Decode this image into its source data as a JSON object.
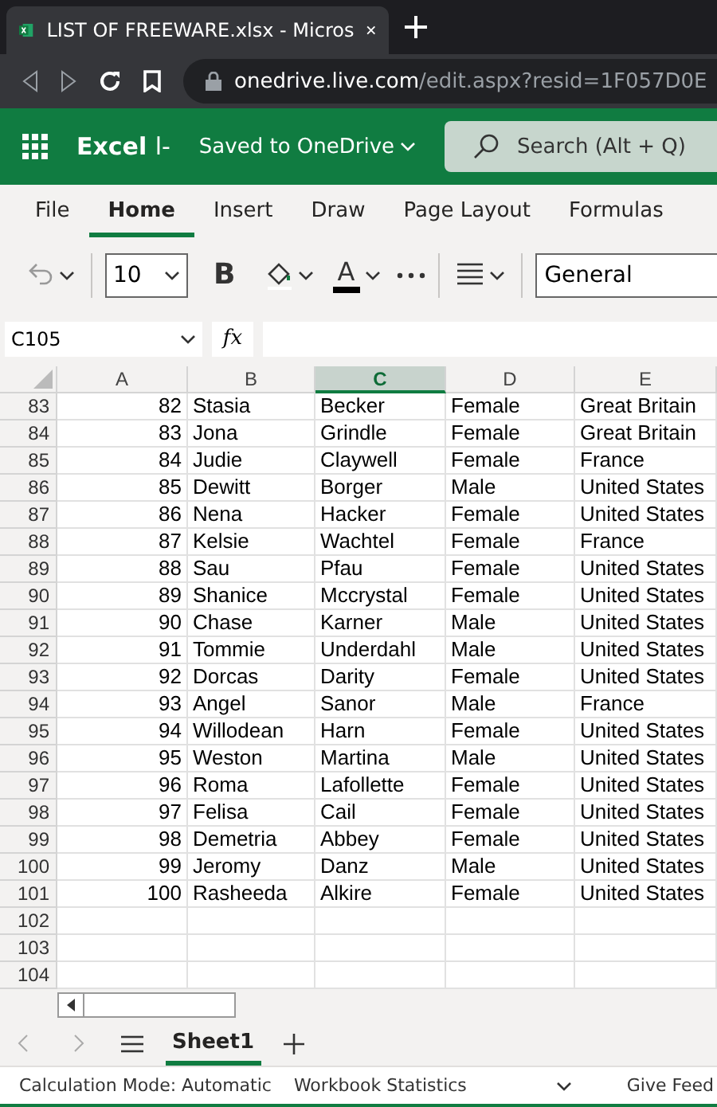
{
  "browser": {
    "tab_title": "LIST OF FREEWARE.xlsx - Micros",
    "url_host": "onedrive.live.com",
    "url_path": "/edit.aspx?resid=1F057D0E"
  },
  "app": {
    "name": "Excel",
    "title_fragment": "l-",
    "status": "Saved to OneDrive",
    "search_placeholder": "Search (Alt + Q)"
  },
  "ribbon_tabs": [
    {
      "label": "File",
      "selected": false
    },
    {
      "label": "Home",
      "selected": true
    },
    {
      "label": "Insert",
      "selected": false
    },
    {
      "label": "Draw",
      "selected": false
    },
    {
      "label": "Page Layout",
      "selected": false
    },
    {
      "label": "Formulas",
      "selected": false
    }
  ],
  "toolbar": {
    "font_size": "10",
    "bold": "B",
    "font_color": "A",
    "number_format": "General"
  },
  "formula_bar": {
    "name_box": "C105",
    "fx": "fx"
  },
  "columns": [
    {
      "label": "A",
      "selected": false
    },
    {
      "label": "B",
      "selected": false
    },
    {
      "label": "C",
      "selected": true
    },
    {
      "label": "D",
      "selected": false
    },
    {
      "label": "E",
      "selected": false
    }
  ],
  "rows": [
    {
      "row": "83",
      "cells": [
        "82",
        "Stasia",
        "Becker",
        "Female",
        "Great Britain"
      ]
    },
    {
      "row": "84",
      "cells": [
        "83",
        "Jona",
        "Grindle",
        "Female",
        "Great Britain"
      ]
    },
    {
      "row": "85",
      "cells": [
        "84",
        "Judie",
        "Claywell",
        "Female",
        "France"
      ]
    },
    {
      "row": "86",
      "cells": [
        "85",
        "Dewitt",
        "Borger",
        "Male",
        "United States"
      ]
    },
    {
      "row": "87",
      "cells": [
        "86",
        "Nena",
        "Hacker",
        "Female",
        "United States"
      ]
    },
    {
      "row": "88",
      "cells": [
        "87",
        "Kelsie",
        "Wachtel",
        "Female",
        "France"
      ]
    },
    {
      "row": "89",
      "cells": [
        "88",
        "Sau",
        "Pfau",
        "Female",
        "United States"
      ]
    },
    {
      "row": "90",
      "cells": [
        "89",
        "Shanice",
        "Mccrystal",
        "Female",
        "United States"
      ]
    },
    {
      "row": "91",
      "cells": [
        "90",
        "Chase",
        "Karner",
        "Male",
        "United States"
      ]
    },
    {
      "row": "92",
      "cells": [
        "91",
        "Tommie",
        "Underdahl",
        "Male",
        "United States"
      ]
    },
    {
      "row": "93",
      "cells": [
        "92",
        "Dorcas",
        "Darity",
        "Female",
        "United States"
      ]
    },
    {
      "row": "94",
      "cells": [
        "93",
        "Angel",
        "Sanor",
        "Male",
        "France"
      ]
    },
    {
      "row": "95",
      "cells": [
        "94",
        "Willodean",
        "Harn",
        "Female",
        "United States"
      ]
    },
    {
      "row": "96",
      "cells": [
        "95",
        "Weston",
        "Martina",
        "Male",
        "United States"
      ]
    },
    {
      "row": "97",
      "cells": [
        "96",
        "Roma",
        "Lafollette",
        "Female",
        "United States"
      ]
    },
    {
      "row": "98",
      "cells": [
        "97",
        "Felisa",
        "Cail",
        "Female",
        "United States"
      ]
    },
    {
      "row": "99",
      "cells": [
        "98",
        "Demetria",
        "Abbey",
        "Female",
        "United States"
      ]
    },
    {
      "row": "100",
      "cells": [
        "99",
        "Jeromy",
        "Danz",
        "Male",
        "United States"
      ]
    },
    {
      "row": "101",
      "cells": [
        "100",
        "Rasheeda",
        "Alkire",
        "Female",
        "United States"
      ]
    },
    {
      "row": "102",
      "cells": []
    },
    {
      "row": "103",
      "cells": []
    },
    {
      "row": "104",
      "cells": []
    }
  ],
  "sheets": [
    {
      "label": "Sheet1",
      "selected": true
    }
  ],
  "status_bar": [
    "Calculation Mode: Automatic",
    "Workbook Statistics",
    "Give Feed"
  ]
}
